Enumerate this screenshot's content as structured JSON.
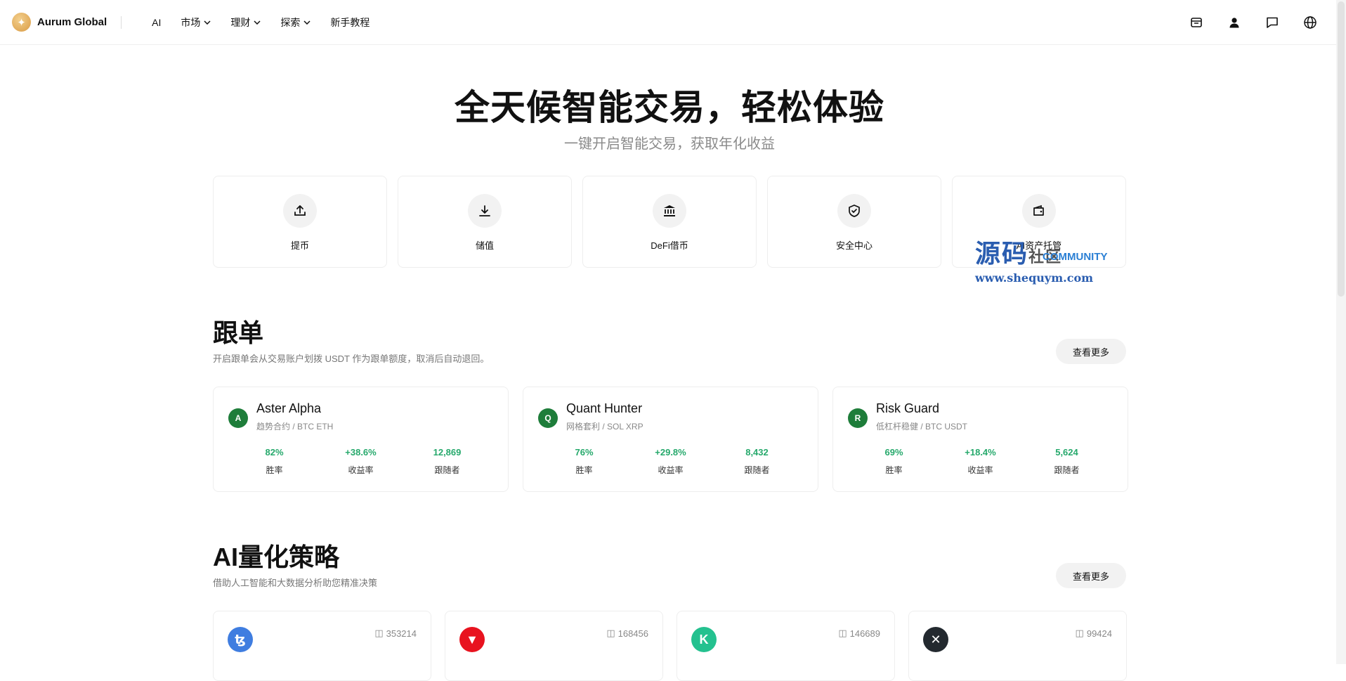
{
  "brand": {
    "name": "Aurum Global"
  },
  "nav": {
    "items": [
      {
        "label": "AI",
        "dropdown": false
      },
      {
        "label": "市场",
        "dropdown": true
      },
      {
        "label": "理财",
        "dropdown": true
      },
      {
        "label": "探索",
        "dropdown": true
      },
      {
        "label": "新手教程",
        "dropdown": false
      }
    ]
  },
  "top_icons": [
    "inbox-icon",
    "user-icon",
    "chat-icon",
    "globe-icon"
  ],
  "hero": {
    "title": "全天候智能交易，轻松体验",
    "subtitle": "一键开启智能交易，获取年化收益"
  },
  "quick_actions": [
    {
      "label": "提币",
      "icon": "upload-icon"
    },
    {
      "label": "储值",
      "icon": "download-icon"
    },
    {
      "label": "DeFi借币",
      "icon": "bank-icon"
    },
    {
      "label": "安全中心",
      "icon": "shield-icon"
    },
    {
      "label": "AI资产托管",
      "icon": "wallet-icon"
    }
  ],
  "watermark": {
    "cn": "源码",
    "cn_small": "社区",
    "en": "COMMUNITY",
    "url": "www.shequym.com"
  },
  "copy_trading": {
    "title": "跟单",
    "desc": "开启跟单会从交易账户划拨 USDT 作为跟单额度，取消后自动退回。",
    "more": "查看更多",
    "traders": [
      {
        "initial": "A",
        "name": "Aster Alpha",
        "tags": "趋势合约 / BTC ETH",
        "stats": [
          {
            "value": "82%",
            "label": "胜率"
          },
          {
            "value": "+38.6%",
            "label": "收益率"
          },
          {
            "value": "12,869",
            "label": "跟随者"
          }
        ]
      },
      {
        "initial": "Q",
        "name": "Quant Hunter",
        "tags": "网格套利 / SOL XRP",
        "stats": [
          {
            "value": "76%",
            "label": "胜率"
          },
          {
            "value": "+29.8%",
            "label": "收益率"
          },
          {
            "value": "8,432",
            "label": "跟随者"
          }
        ]
      },
      {
        "initial": "R",
        "name": "Risk Guard",
        "tags": "低杠杆稳健 / BTC USDT",
        "stats": [
          {
            "value": "69%",
            "label": "胜率"
          },
          {
            "value": "+18.4%",
            "label": "收益率"
          },
          {
            "value": "5,624",
            "label": "跟随者"
          }
        ]
      }
    ]
  },
  "ai_strategy": {
    "title": "AI量化策略",
    "desc": "借助人工智能和大数据分析助您精准决策",
    "more": "查看更多",
    "cards": [
      {
        "coin": "tezos-icon",
        "color": "#3f7de0",
        "glyph": "ꜩ",
        "count": "353214"
      },
      {
        "coin": "tron-icon",
        "color": "#e8131f",
        "glyph": "▼",
        "count": "168456"
      },
      {
        "coin": "kucoin-icon",
        "color": "#24c18f",
        "glyph": "K",
        "count": "146689"
      },
      {
        "coin": "xrp-icon",
        "color": "#23292f",
        "glyph": "✕",
        "count": "99424"
      }
    ]
  },
  "colors": {
    "accent_green": "#26a96c",
    "avatar_green": "#1e7d3a",
    "brand_gold": "#d99b45"
  }
}
